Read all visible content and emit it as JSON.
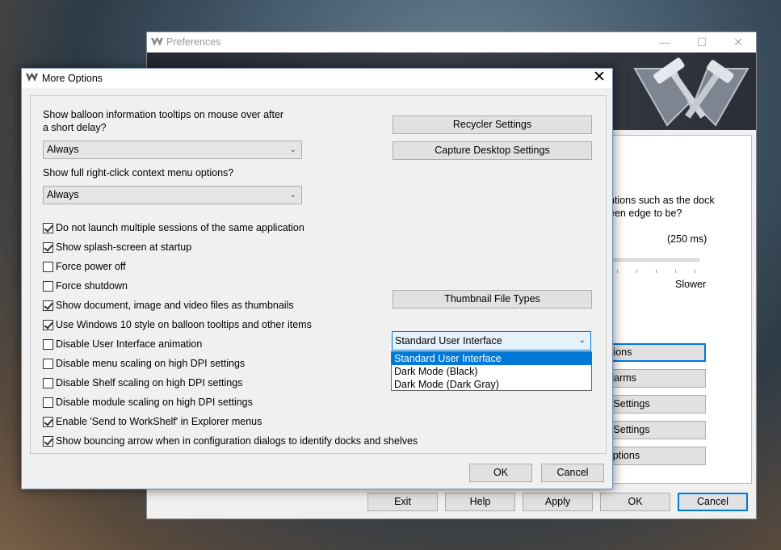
{
  "preferences": {
    "title": "Preferences",
    "panel_text_line1": "ntions such as the dock",
    "panel_text_line2": "een edge to be?",
    "delay_value": "(250 ms)",
    "slower_label": "Slower",
    "panel_buttons": [
      "ptions",
      "Alarms",
      "p Settings",
      "e Settings",
      "Options"
    ],
    "footer": {
      "exit": "Exit",
      "help": "Help",
      "apply": "Apply",
      "ok": "OK",
      "cancel": "Cancel"
    },
    "caption": {
      "minimize": "—",
      "maximize": "☐",
      "close": "✕"
    }
  },
  "dialog": {
    "title": "More Options",
    "close": "✕",
    "tooltip_label_line1": "Show balloon information tooltips on mouse over after",
    "tooltip_label_line2": "a short delay?",
    "tooltip_combo_value": "Always",
    "context_label": "Show full right-click context menu options?",
    "context_combo_value": "Always",
    "checkboxes": [
      {
        "label": "Do not launch multiple sessions of the same application",
        "checked": true
      },
      {
        "label": "Show splash-screen at startup",
        "checked": true
      },
      {
        "label": "Force power off",
        "checked": false
      },
      {
        "label": "Force shutdown",
        "checked": false
      },
      {
        "label": "Show document, image and video files as thumbnails",
        "checked": true
      },
      {
        "label": "Use Windows 10 style on balloon tooltips and other items",
        "checked": true
      },
      {
        "label": "Disable User Interface animation",
        "checked": false
      },
      {
        "label": "Disable menu scaling on high DPI settings",
        "checked": false
      },
      {
        "label": "Disable Shelf scaling on high DPI settings",
        "checked": false
      },
      {
        "label": "Disable module scaling on high DPI settings",
        "checked": false
      },
      {
        "label": "Enable 'Send to WorkShelf' in Explorer menus",
        "checked": true
      },
      {
        "label": "Show bouncing arrow when in configuration dialogs to identify docks and shelves",
        "checked": true
      }
    ],
    "recycler_button": "Recycler Settings",
    "capture_button": "Capture Desktop Settings",
    "thumbnail_button": "Thumbnail File Types",
    "ui_dropdown": {
      "selected": "Standard User Interface",
      "options": [
        "Standard User Interface",
        "Dark Mode (Black)",
        "Dark Mode (Dark Gray)"
      ],
      "highlighted": 0
    },
    "ok": "OK",
    "cancel": "Cancel"
  }
}
